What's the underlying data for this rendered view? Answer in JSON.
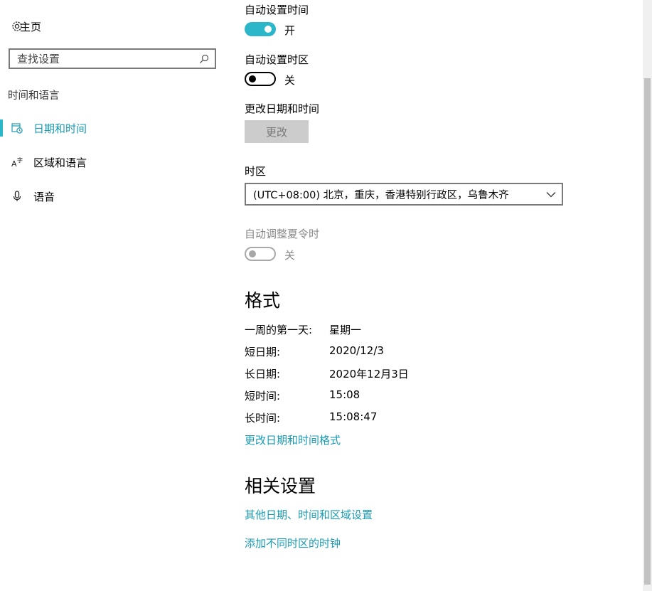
{
  "sidebar": {
    "home_label": "主页",
    "search_placeholder": "查找设置",
    "section_label": "时间和语言",
    "items": [
      {
        "label": "日期和时间",
        "icon": "date-time-icon",
        "active": true
      },
      {
        "label": "区域和语言",
        "icon": "region-language-icon",
        "active": false
      },
      {
        "label": "语音",
        "icon": "microphone-icon",
        "active": false
      }
    ]
  },
  "main": {
    "auto_time": {
      "label": "自动设置时间",
      "state": "开",
      "on": true
    },
    "auto_timezone": {
      "label": "自动设置时区",
      "state": "关",
      "on": false
    },
    "change_datetime": {
      "label": "更改日期和时间",
      "button": "更改"
    },
    "timezone": {
      "label": "时区",
      "value": "(UTC+08:00) 北京，重庆，香港特别行政区，乌鲁木齐"
    },
    "dst": {
      "label": "自动调整夏令时",
      "state": "关",
      "enabled": false
    },
    "format": {
      "heading": "格式",
      "rows": [
        {
          "key": "一周的第一天:",
          "value": "星期一"
        },
        {
          "key": "短日期:",
          "value": "2020/12/3"
        },
        {
          "key": "长日期:",
          "value": "2020年12月3日"
        },
        {
          "key": "短时间:",
          "value": "15:08"
        },
        {
          "key": "长时间:",
          "value": "15:08:47"
        }
      ],
      "link": "更改日期和时间格式"
    },
    "related": {
      "heading": "相关设置",
      "links": [
        "其他日期、时间和区域设置",
        "添加不同时区的时钟"
      ]
    }
  },
  "colors": {
    "accent": "#2bb7c9",
    "link": "#1a9bb4",
    "disabled": "#8a8a8a"
  }
}
